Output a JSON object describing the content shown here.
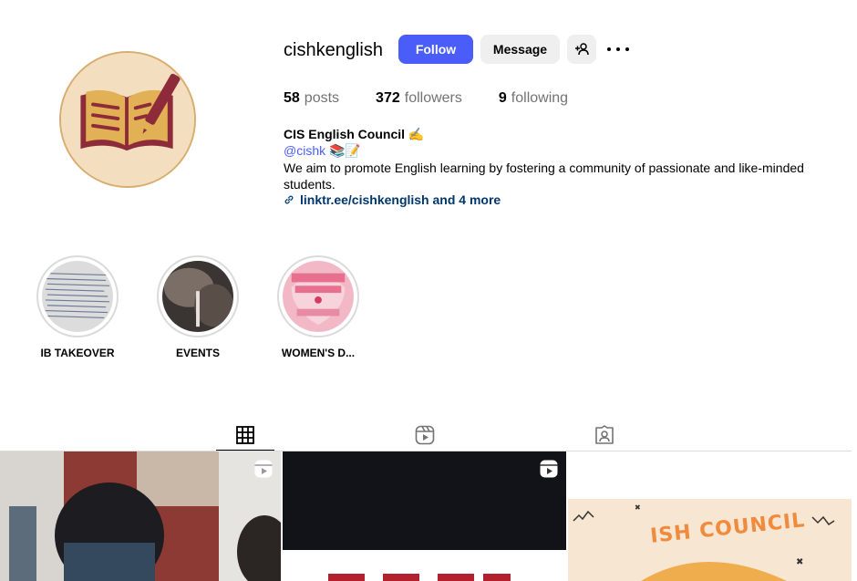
{
  "profile": {
    "username": "cishkenglish",
    "follow_label": "Follow",
    "message_label": "Message",
    "stats": {
      "posts_count": "58",
      "posts_label": "posts",
      "followers_count": "372",
      "followers_label": "followers",
      "following_count": "9",
      "following_label": "following"
    },
    "full_name": "CIS English Council ✍️",
    "handle": "@cishk 📚📝",
    "bio": "We aim to promote English learning by fostering a community of passionate and like-minded students.",
    "link": "linktr.ee/cishkenglish and 4 more"
  },
  "highlights": [
    {
      "label": "IB TAKEOVER"
    },
    {
      "label": "EVENTS"
    },
    {
      "label": "WOMEN'S D..."
    }
  ],
  "tabs": [
    {
      "name": "posts",
      "icon": "grid-icon",
      "active": true
    },
    {
      "name": "reels",
      "icon": "reels-icon",
      "active": false
    },
    {
      "name": "tagged",
      "icon": "tagged-icon",
      "active": false
    }
  ],
  "posts_grid": [
    {
      "type": "reel"
    },
    {
      "type": "reel"
    },
    {
      "type": "post",
      "text": "ISH COUNCIL"
    }
  ],
  "colors": {
    "follow_button": "#4a5df9",
    "secondary_button": "#efefef",
    "link": "#00376b",
    "handle": "#4a5df9"
  }
}
